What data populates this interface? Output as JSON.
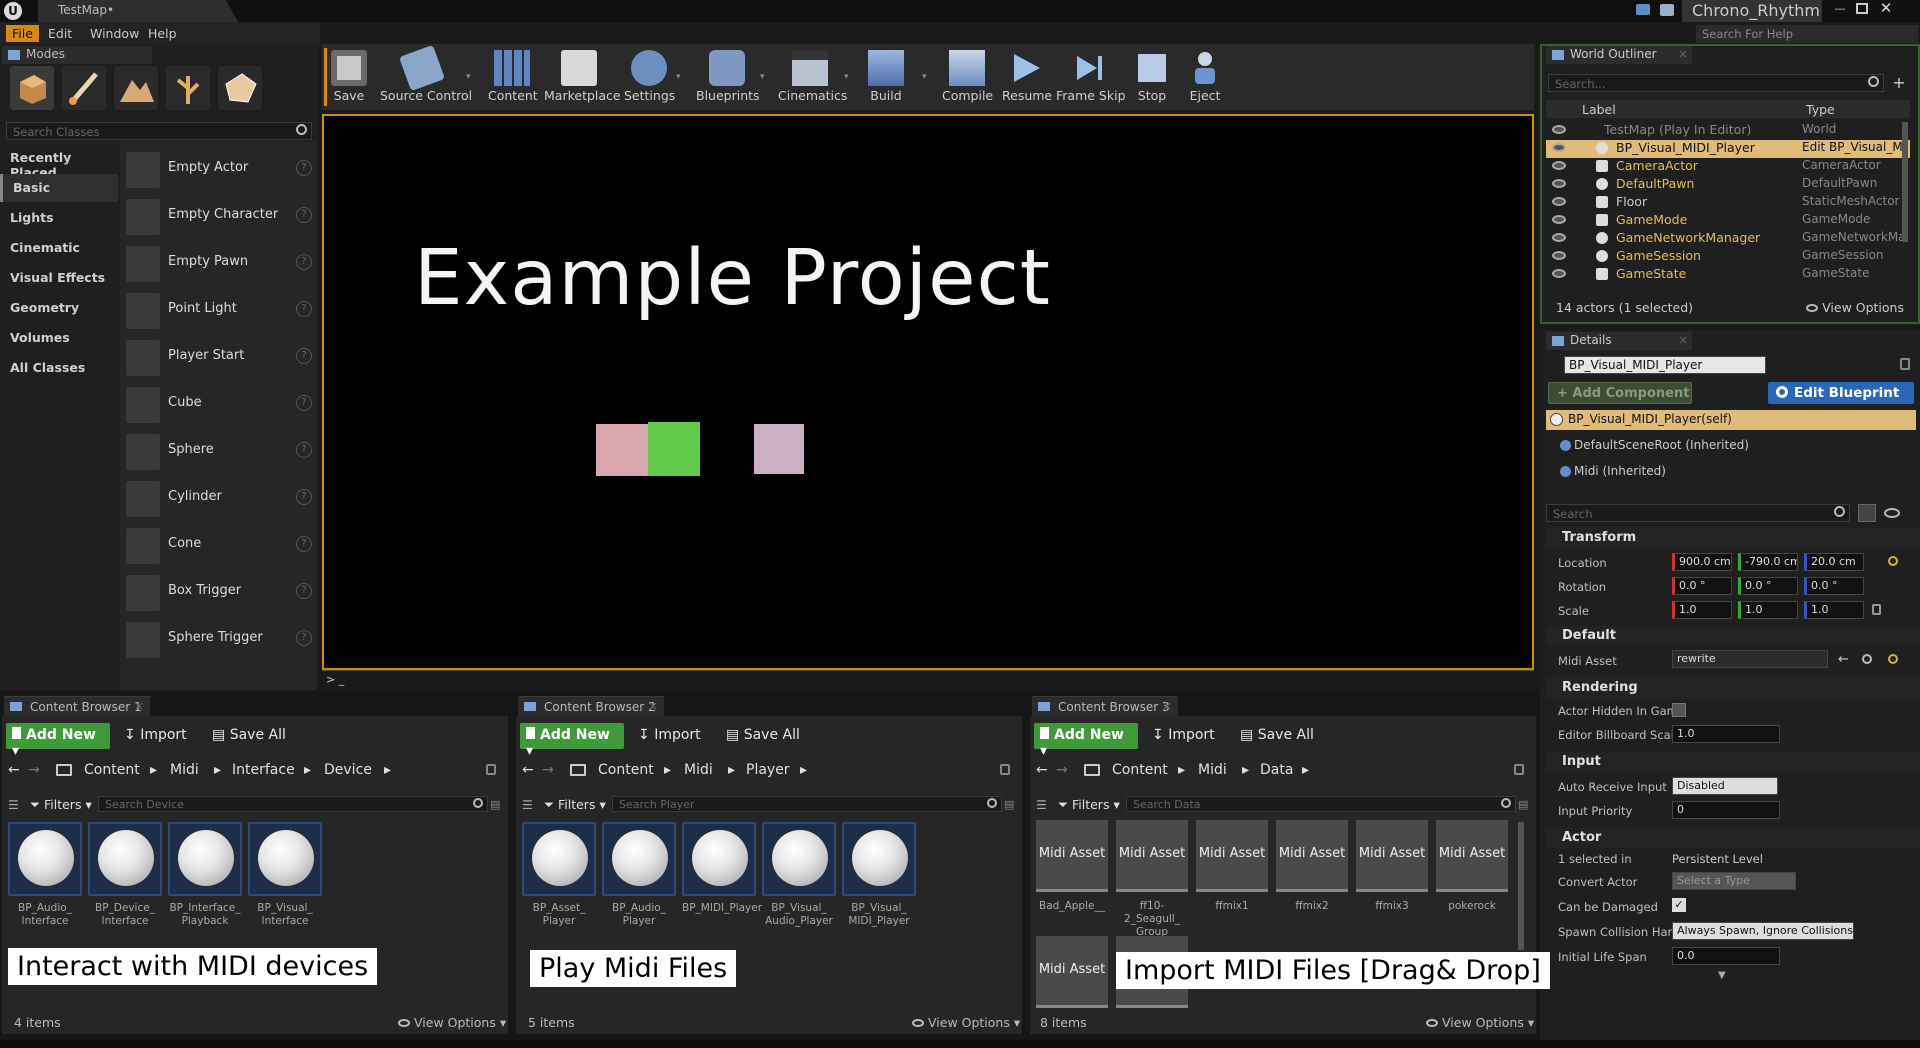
{
  "window": {
    "doc_tab": "TestMap•",
    "project": "Chrono_Rhythm",
    "help_search_placeholder": "Search For Help"
  },
  "menu": [
    "File",
    "Edit",
    "Window",
    "Help"
  ],
  "modes": {
    "tab": "Modes",
    "search_placeholder": "Search Classes",
    "categories": [
      "Recently Placed",
      "Basic",
      "Lights",
      "Cinematic",
      "Visual Effects",
      "Geometry",
      "Volumes",
      "All Classes"
    ],
    "selected_category": "Basic",
    "items": [
      "Empty Actor",
      "Empty Character",
      "Empty Pawn",
      "Point Light",
      "Player Start",
      "Cube",
      "Sphere",
      "Cylinder",
      "Cone",
      "Box Trigger",
      "Sphere Trigger"
    ],
    "help_glyph": "?"
  },
  "toolbar": {
    "tools": [
      "Save",
      "Source Control",
      "Content",
      "Marketplace",
      "Settings",
      "Blueprints",
      "Cinematics",
      "Build",
      "Compile",
      "Resume",
      "Frame Skip",
      "Stop",
      "Eject"
    ],
    "dropdown_glyph": "▾"
  },
  "viewport": {
    "title": "Example Project",
    "console_prompt": "> _",
    "cube_colors": [
      "#d8a7ad",
      "#63c94a",
      "#cdb0c6"
    ]
  },
  "outliner": {
    "tab": "World Outliner",
    "search_placeholder": "Search...",
    "col_label": "Label",
    "col_type": "Type",
    "rows": [
      {
        "name": "TestMap (Play In Editor)",
        "type": "World"
      },
      {
        "name": "BP_Visual_MIDI_Player",
        "type": "Edit BP_Visual_M"
      },
      {
        "name": "CameraActor",
        "type": "CameraActor"
      },
      {
        "name": "DefaultPawn",
        "type": "DefaultPawn"
      },
      {
        "name": "Floor",
        "type": "StaticMeshActor"
      },
      {
        "name": "GameMode",
        "type": "GameMode"
      },
      {
        "name": "GameNetworkManager",
        "type": "GameNetworkMar"
      },
      {
        "name": "GameSession",
        "type": "GameSession"
      },
      {
        "name": "GameState",
        "type": "GameState"
      }
    ],
    "footer": "14 actors (1 selected)",
    "view_options": "View Options"
  },
  "details": {
    "tab": "Details",
    "actor_name": "BP_Visual_MIDI_Player",
    "add_component": "+ Add Component",
    "edit_blueprint": "Edit Blueprint",
    "components": [
      "BP_Visual_MIDI_Player(self)",
      "DefaultSceneRoot (Inherited)",
      "Midi (Inherited)"
    ],
    "search_placeholder": "Search",
    "sections": {
      "transform": "Transform",
      "default": "Default",
      "rendering": "Rendering",
      "input": "Input",
      "actor": "Actor"
    },
    "transform": {
      "location_label": "Location",
      "location": [
        "900.0 cm",
        "-790.0 cm",
        "20.0 cm"
      ],
      "rotation_label": "Rotation",
      "rotation": [
        "0.0 °",
        "0.0 °",
        "0.0 °"
      ],
      "scale_label": "Scale",
      "scale": [
        "1.0",
        "1.0",
        "1.0"
      ]
    },
    "default": {
      "midi_asset_label": "Midi Asset",
      "midi_asset_value": "rewrite"
    },
    "rendering": {
      "hidden_label": "Actor Hidden In Game",
      "billboard_label": "Editor Billboard Scale",
      "billboard_value": "1.0"
    },
    "input": {
      "auto_label": "Auto Receive Input",
      "auto_value": "Disabled",
      "priority_label": "Input Priority",
      "priority_value": "0"
    },
    "actor": {
      "selected_label": "1 selected in",
      "selected_value": "Persistent Level",
      "convert_label": "Convert Actor",
      "convert_value": "Select a Type",
      "can_damage_label": "Can be Damaged",
      "spawn_label": "Spawn Collision Hand",
      "spawn_value": "Always Spawn, Ignore Collisions",
      "life_label": "Initial Life Span",
      "life_value": "0.0"
    }
  },
  "content_browsers": [
    {
      "tab": "Content Browser 1",
      "add_new": "Add New",
      "import": "Import",
      "save_all": "Save All",
      "path": [
        "Content",
        "Midi",
        "Interface",
        "Device"
      ],
      "filters": "Filters",
      "search_placeholder": "Search Device",
      "assets": [
        [
          "BP_Audio_",
          "Interface"
        ],
        [
          "BP_Device_",
          "Interface"
        ],
        [
          "BP_Interface_",
          "Playback"
        ],
        [
          "BP_Visual_",
          "Interface"
        ]
      ],
      "caption": "Interact with MIDI devices",
      "count": "4 items",
      "view_options": "View Options"
    },
    {
      "tab": "Content Browser 2",
      "add_new": "Add New",
      "import": "Import",
      "save_all": "Save All",
      "path": [
        "Content",
        "Midi",
        "Player"
      ],
      "filters": "Filters",
      "search_placeholder": "Search Player",
      "assets": [
        [
          "BP_Asset_",
          "Player"
        ],
        [
          "BP_Audio_",
          "Player"
        ],
        [
          "BP_MIDI_Player",
          ""
        ],
        [
          "BP_Visual_",
          "Audio_Player"
        ],
        [
          "BP_Visual_",
          "MIDI_Player"
        ]
      ],
      "caption": "Play Midi Files",
      "count": "5 items",
      "view_options": "View Options"
    },
    {
      "tab": "Content Browser 3",
      "add_new": "Add New",
      "import": "Import",
      "save_all": "Save All",
      "path": [
        "Content",
        "Midi",
        "Data"
      ],
      "filters": "Filters",
      "search_placeholder": "Search Data",
      "asset_thumb_label": "Midi Asset",
      "assets": [
        [
          "Bad_Apple__",
          ""
        ],
        [
          "ff10-2_Seagull_",
          "Group"
        ],
        [
          "ffmix1",
          ""
        ],
        [
          "ffmix2",
          ""
        ],
        [
          "ffmix3",
          ""
        ],
        [
          "pokerock",
          ""
        ]
      ],
      "caption": "Import MIDI Files [Drag& Drop]",
      "count": "8 items",
      "view_options": "View Options"
    }
  ]
}
